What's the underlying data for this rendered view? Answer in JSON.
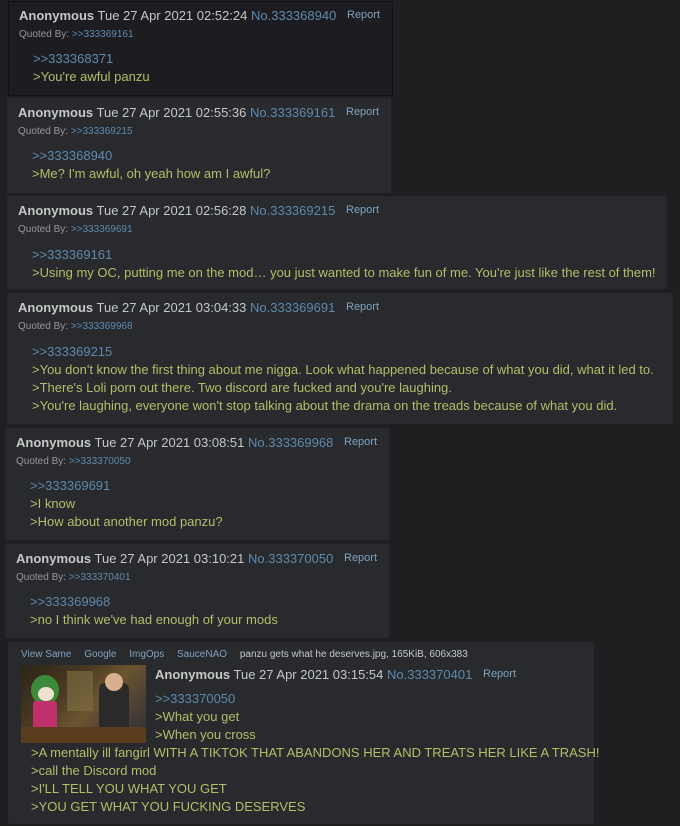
{
  "posts": [
    {
      "name": "Anonymous",
      "date": "Tue 27 Apr 2021 02:52:24",
      "number": "No.333368940",
      "report": "Report",
      "quoted_by_label": "Quoted By:",
      "quoted_by": ">>333369161",
      "lines": [
        ">>333368371",
        ">You're awful panzu"
      ]
    },
    {
      "name": "Anonymous",
      "date": "Tue 27 Apr 2021 02:55:36",
      "number": "No.333369161",
      "report": "Report",
      "quoted_by_label": "Quoted By:",
      "quoted_by": ">>333369215",
      "lines": [
        ">>333368940",
        ">Me? I'm awful, oh yeah how am I awful?"
      ]
    },
    {
      "name": "Anonymous",
      "date": "Tue 27 Apr 2021 02:56:28",
      "number": "No.333369215",
      "report": "Report",
      "quoted_by_label": "Quoted By:",
      "quoted_by": ">>333369691",
      "lines": [
        ">>333369161",
        ">Using my OC, putting me on the mod… you just wanted to make fun of me. You're just like the rest of them!"
      ]
    },
    {
      "name": "Anonymous",
      "date": "Tue 27 Apr 2021 03:04:33",
      "number": "No.333369691",
      "report": "Report",
      "quoted_by_label": "Quoted By:",
      "quoted_by": ">>333369968",
      "lines": [
        ">>333369215",
        ">You don't know the first thing about me nigga. Look what happened because of what you did, what it led to.",
        ">There's Loli porn out there. Two discord are fucked and you're laughing.",
        ">You're laughing, everyone won't stop talking about the drama on the treads because of what you did."
      ]
    },
    {
      "name": "Anonymous",
      "date": "Tue 27 Apr 2021 03:08:51",
      "number": "No.333369968",
      "report": "Report",
      "quoted_by_label": "Quoted By:",
      "quoted_by": ">>333370050",
      "lines": [
        ">>333369691",
        ">I know",
        ">How about another mod panzu?"
      ]
    },
    {
      "name": "Anonymous",
      "date": "Tue 27 Apr 2021 03:10:21",
      "number": "No.333370050",
      "report": "Report",
      "quoted_by_label": "Quoted By:",
      "quoted_by": ">>333370401",
      "lines": [
        ">>333369968",
        ">no I think we've had enough of your mods"
      ]
    },
    {
      "name": "Anonymous",
      "date": "Tue 27 Apr 2021 03:15:54",
      "number": "No.333370401",
      "report": "Report",
      "file": {
        "services": [
          "View Same",
          "Google",
          "ImgOps",
          "SauceNAO"
        ],
        "filename": "panzu gets what he deserves.jpg",
        "meta": ", 165KiB, 606x383"
      },
      "lines": [
        ">>333370050",
        ">What you get",
        ">When you cross",
        ">A mentally ill fangirl WITH A TIKTOK THAT ABANDONS HER AND TREATS HER LIKE A TRASH!",
        ">call the Discord mod",
        ">I'LL TELL YOU WHAT YOU GET",
        ">YOU GET WHAT YOU FUCKING DESERVES"
      ]
    }
  ]
}
